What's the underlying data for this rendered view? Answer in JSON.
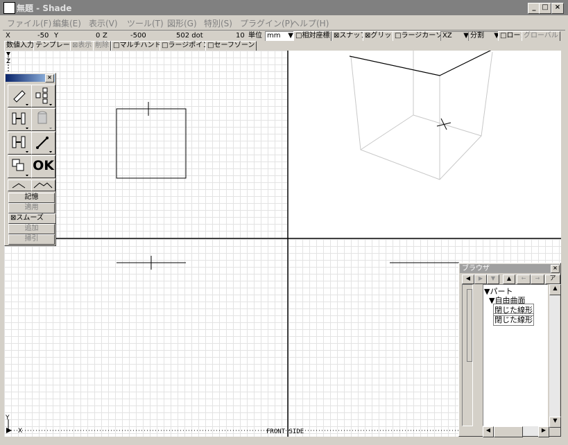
{
  "window": {
    "title": "無題 - Shade",
    "minimize": "_",
    "maximize": "□",
    "close": "×"
  },
  "menu": [
    "ファイル(F)",
    "編集(E)",
    "表示(V)",
    "ツール(T)",
    "図形(G)",
    "特別(S)",
    "プラグイン(P)",
    "ヘルプ(H)"
  ],
  "coords": {
    "x_label": "X",
    "x_value": "-50",
    "y_label": "Y",
    "y_value": "0",
    "z_label": "Z",
    "z_value": "-500",
    "dot_value": "502 dot",
    "grid_value": "10",
    "unit_label": "単位",
    "unit_value": "mm"
  },
  "toggles": {
    "relative": "□相対座標",
    "snap": "⊠スナップ",
    "grid": "⊠グリッド",
    "large_cursor": "□ラージカーソル",
    "plane": "XZ",
    "split": "分割",
    "local": "□ローカル",
    "global": "グローバル"
  },
  "row2": {
    "numeric": "数値入力",
    "template": "テンプレート",
    "show": "⊠表示",
    "delete": "削除",
    "multi": "□マルチハンドル",
    "large_point": "□ラージポイント",
    "safe_zone": "□セーフゾーン"
  },
  "palette": {
    "ok": "OK",
    "memory": "記憶",
    "apply": "適用",
    "smooth": "⊠スムーズ",
    "add": "追加",
    "subtract": "掃引",
    "close": "×"
  },
  "browser": {
    "title": "ブラウザ",
    "close": "×",
    "action": "ア",
    "items": [
      "▼パート",
      "▼自由曲面",
      "閉じた線形",
      "閉じた線形"
    ]
  },
  "axes": {
    "z_axis": "Z",
    "y_axis": "Y",
    "x_axis": "X",
    "view_label": "FRONT SIDE"
  }
}
